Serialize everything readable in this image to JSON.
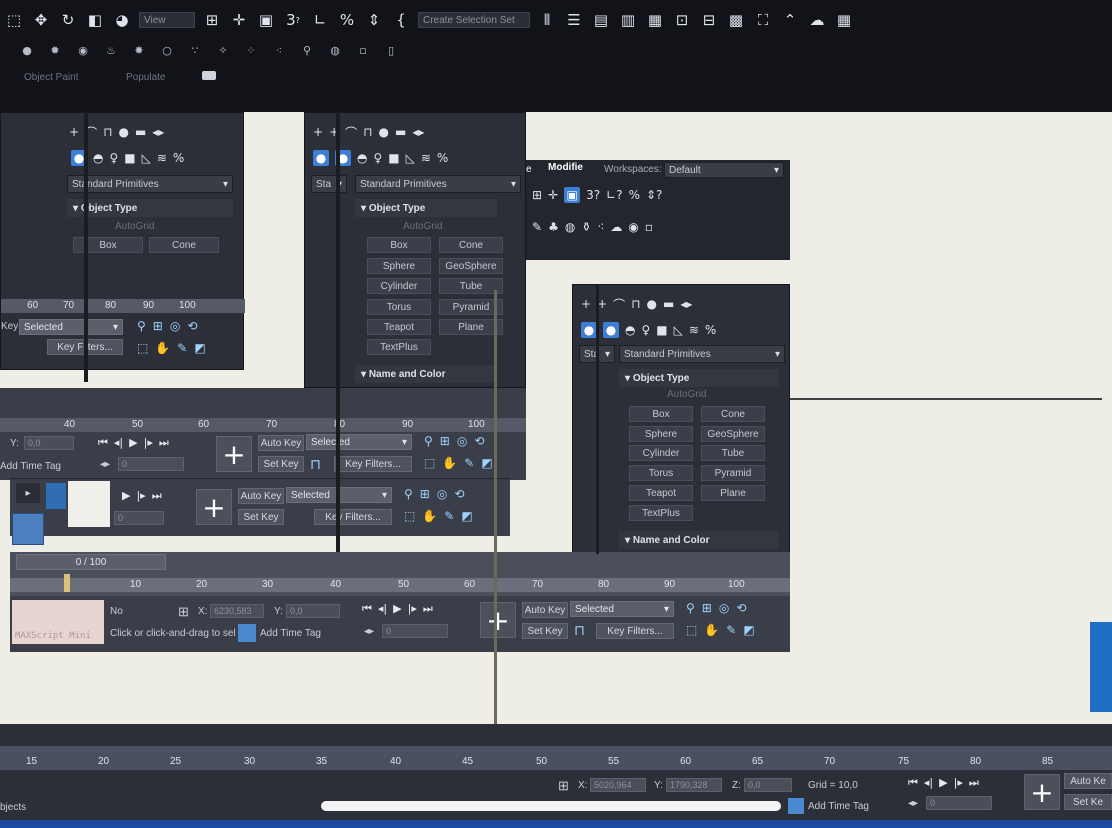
{
  "toolbar": {
    "view_dropdown": "View",
    "selection_set": "Create Selection Set",
    "snaps_text": "3",
    "panel_tabs": [
      "Object Paint",
      "Populate"
    ]
  },
  "panel_left": {
    "category": "Standard Primitives",
    "rollout": "Object Type",
    "autogrid": "AutoGrid",
    "buttons": [
      "Box",
      "Cone"
    ]
  },
  "panel_middle": {
    "tab_fragment": "Sta",
    "category": "Standard Primitives",
    "rollout": "Object Type",
    "autogrid": "AutoGrid",
    "buttons": [
      "Box",
      "Cone",
      "Sphere",
      "GeoSphere",
      "Cylinder",
      "Tube",
      "Torus",
      "Pyramid",
      "Teapot",
      "Plane",
      "TextPlus"
    ],
    "name_color": "Name and Color"
  },
  "panel_right": {
    "tab_fragment": "Sta",
    "category": "Standard Primitives",
    "rollout": "Object Type",
    "autogrid": "AutoGrid",
    "buttons": [
      "Box",
      "Cone",
      "Sphere",
      "GeoSphere",
      "Cylinder",
      "Tube",
      "Torus",
      "Pyramid",
      "Teapot",
      "Plane",
      "TextPlus"
    ],
    "name_color": "Name and Color"
  },
  "menubar_window": {
    "menu_fragment": "e",
    "modify": "Modifie",
    "workspaces_label": "Workspaces:",
    "workspaces_value": "Default"
  },
  "timeline_top": {
    "ticks": [
      "60",
      "70",
      "80",
      "90",
      "100"
    ],
    "key_label": "Key",
    "key_filter_label": "Key Filters...",
    "selected": "Selected"
  },
  "timeline_mid": {
    "ticks": [
      "40",
      "50",
      "60",
      "70",
      "80",
      "90",
      "100"
    ],
    "y_label": "Y:",
    "y_value": "0,0",
    "add_time_tag": "Add Time Tag",
    "frame_value": "0",
    "auto_key": "Auto Key",
    "set_key": "Set Key",
    "selected": "Selected",
    "key_filters": "Key Filters..."
  },
  "timeline_second": {
    "frame_value": "0",
    "auto_key": "Auto Key",
    "set_key": "Set Key",
    "selected": "Selected",
    "key_filters": "Key Filters..."
  },
  "time_slider": {
    "position": "0 / 100",
    "ticks": [
      "10",
      "20",
      "30",
      "40",
      "50",
      "60",
      "70",
      "80",
      "90",
      "100"
    ]
  },
  "status_window": {
    "script_box": "MAXScript Mini",
    "no_label": "No",
    "prompt": "Click or click-and-drag to sel",
    "x_label": "X:",
    "x_value": "6230,583",
    "y_label": "Y:",
    "y_value": "0,0",
    "add_time_tag": "Add Time Tag",
    "frame_value": "0",
    "auto_key": "Auto Key",
    "set_key": "Set Key",
    "selected": "Selected",
    "key_filters": "Key Filters..."
  },
  "bottom_bar": {
    "ruler_ticks": [
      "15",
      "20",
      "25",
      "30",
      "35",
      "40",
      "45",
      "50",
      "55",
      "60",
      "65",
      "70",
      "75",
      "80",
      "85"
    ],
    "x_label": "X:",
    "x_value": "5020,964",
    "y_label": "Y:",
    "y_value": "1790,328",
    "z_label": "Z:",
    "z_value": "0,0",
    "grid": "Grid = 10,0",
    "add_time_tag": "Add Time Tag",
    "frame_value": "0",
    "auto_key": "Auto Ke",
    "set_key": "Set Ke",
    "objects": "bjects"
  }
}
